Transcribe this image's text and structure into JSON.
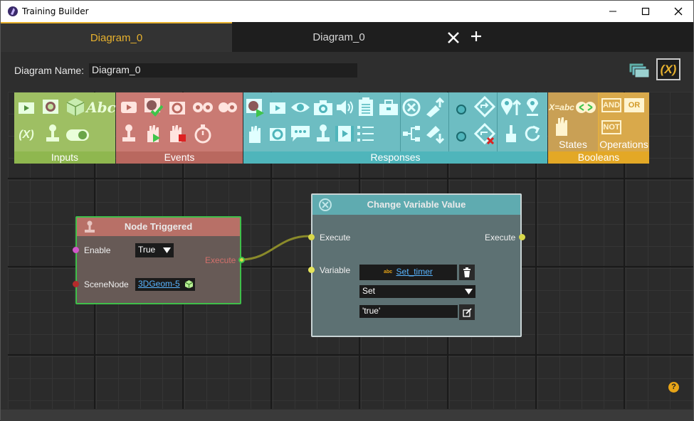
{
  "window": {
    "title": "Training Builder",
    "controls": {
      "minimize": "minimize-icon",
      "maximize": "maximize-icon",
      "close": "close-icon"
    }
  },
  "tabs": [
    {
      "label": "Diagram_0",
      "active": true
    },
    {
      "label": "Diagram_0",
      "active": false
    }
  ],
  "diagram_name": {
    "label": "Diagram Name:",
    "value": "Diagram_0"
  },
  "palette": {
    "sections": [
      {
        "label": "Inputs",
        "color": "#9ebf63",
        "label_color": "#8fb74f"
      },
      {
        "label": "Events",
        "color": "#c97a73",
        "label_color": "#b9685f"
      },
      {
        "label": "Responses",
        "color": "#6dbdc2",
        "label_color": "#4fb5bb"
      },
      {
        "label": "Booleans",
        "color": "#e9b13b",
        "label_color": "#e3a826"
      }
    ],
    "sublabels": {
      "states": "States",
      "operations": "Operations"
    },
    "bool_ops": {
      "and": "AND",
      "or": "OR",
      "not": "NOT"
    },
    "inputs_text": {
      "abc": "Abc",
      "var": "(X)"
    },
    "states_text": "X=abc"
  },
  "nodes": {
    "node_triggered": {
      "title": "Node Triggered",
      "enable_label": "Enable",
      "enable_value": "True",
      "scenenode_label": "SceneNode",
      "scenenode_value": "3DGeom-5",
      "execute_label": "Execute"
    },
    "change_variable": {
      "title": "Change Variable Value",
      "execute_in": "Execute",
      "execute_out": "Execute",
      "variable_label": "Variable",
      "variable_value": "Set_timer",
      "variable_prefix": "abc",
      "operation_value": "Set",
      "value_text": "'true'"
    }
  },
  "help": "?",
  "colors": {
    "accent": "#e7b12e",
    "port_yellow": "#d8d84a",
    "link": "#8a8a2a"
  }
}
